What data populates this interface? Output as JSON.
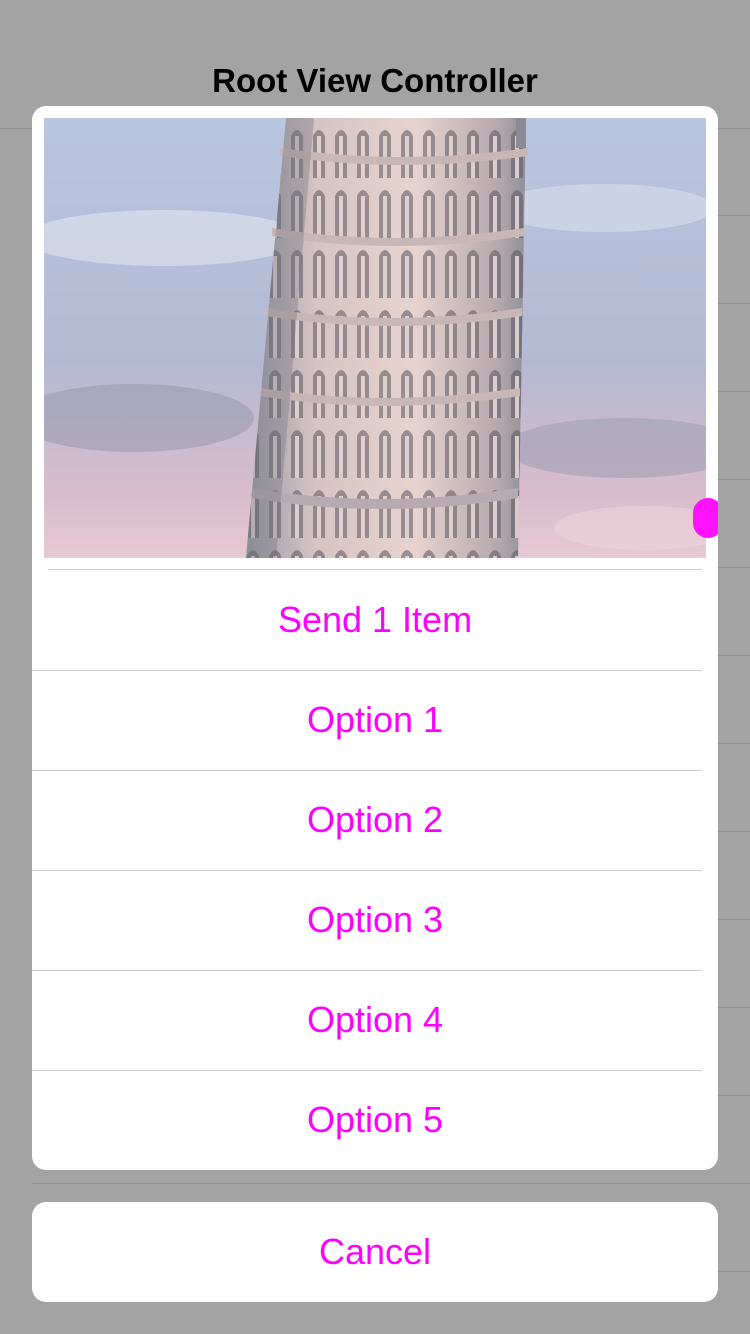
{
  "nav": {
    "title": "Root View Controller"
  },
  "action_sheet": {
    "image_subject": "leaning-tower-of-pisa",
    "actions": [
      {
        "label": "Send 1 Item"
      },
      {
        "label": "Option 1"
      },
      {
        "label": "Option 2"
      },
      {
        "label": "Option 3"
      },
      {
        "label": "Option 4"
      },
      {
        "label": "Option 5"
      }
    ],
    "cancel_label": "Cancel"
  },
  "colors": {
    "tint": "#ff00ff",
    "dim_background": "#a3a3a3",
    "sheet_background": "#ffffff"
  }
}
